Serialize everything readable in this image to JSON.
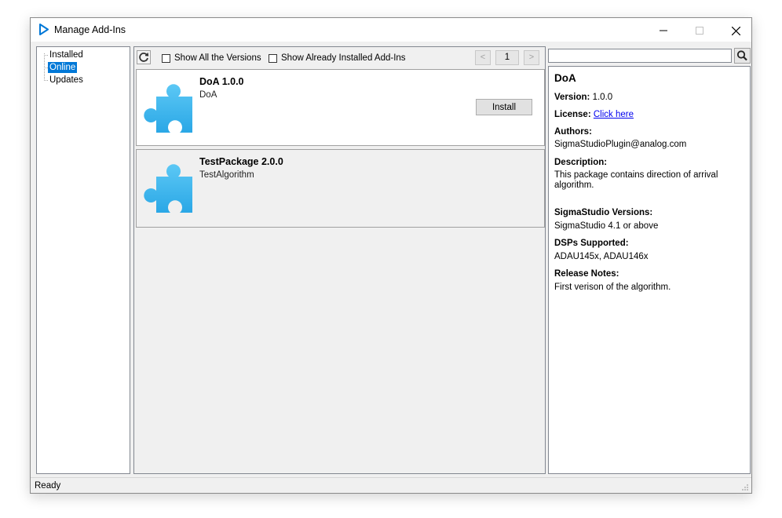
{
  "window": {
    "title": "Manage Add-Ins",
    "title_icon": "play-arrow-icon"
  },
  "titlebar": {
    "minimize_icon": "minimize-icon",
    "maximize_icon": "maximize-icon",
    "close_icon": "close-icon"
  },
  "tree": {
    "items": [
      {
        "label": "Installed"
      },
      {
        "label": "Online",
        "selected": true
      },
      {
        "label": "Updates"
      }
    ]
  },
  "toolbar": {
    "refresh_icon": "refresh-icon",
    "show_all_versions": "Show All the Versions",
    "show_installed": "Show Already Installed Add-Ins",
    "prev_icon": "chevron-left-icon",
    "page": "1",
    "next_icon": "chevron-right-icon"
  },
  "packages": [
    {
      "name": "DoA 1.0.0",
      "description": "DoA",
      "action": "Install",
      "selected": true,
      "icon": "puzzle-piece-icon"
    },
    {
      "name": "TestPackage 2.0.0",
      "description": "TestAlgorithm",
      "selected": false,
      "icon": "puzzle-piece-icon"
    }
  ],
  "search": {
    "value": "",
    "icon": "search-icon"
  },
  "details": {
    "name": "DoA",
    "version_label": "Version:",
    "version": "1.0.0",
    "license_label": "License:",
    "license_link": "Click here",
    "authors_label": "Authors:",
    "authors": "SigmaStudioPlugin@analog.com",
    "description_label": "Description:",
    "description": "This package contains direction of arrival algorithm.",
    "versions_label": "SigmaStudio Versions:",
    "versions": "SigmaStudio 4.1 or above",
    "dsps_label": "DSPs Supported:",
    "dsps": "ADAU145x, ADAU146x",
    "notes_label": "Release Notes:",
    "notes": "First verison of the algorithm."
  },
  "status": {
    "text": "Ready"
  },
  "colors": {
    "selection": "#0078d7",
    "puzzle": "#3fb6ee",
    "link": "#0000ee"
  }
}
